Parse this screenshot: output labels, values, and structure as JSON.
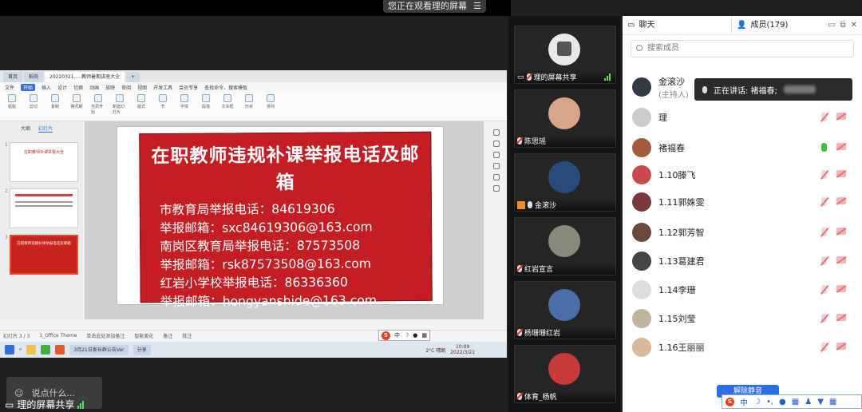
{
  "banner": {
    "text": "您正在观看理的屏幕"
  },
  "share_label": "理的屏幕共享",
  "chat_placeholder": "说点什么...",
  "ppt": {
    "tabs": [
      "首页",
      "稻壳",
      "20220321.....教师暑期讲座大全",
      "+"
    ],
    "menus": [
      "文件",
      "开始",
      "插入",
      "设计",
      "切换",
      "动画",
      "放映",
      "审阅",
      "视图",
      "开发工具",
      "会员专享",
      "查找命令、搜索模板"
    ],
    "ribbon": [
      "粘贴",
      "剪切",
      "复制",
      "格式刷",
      "当页开始",
      "新建幻灯片",
      "版式",
      "节",
      "字体",
      "段落",
      "文本框",
      "形状",
      "排列"
    ],
    "pane_tabs": [
      "大纲",
      "幻灯片"
    ],
    "slide_numbers": [
      "1",
      "2",
      "3"
    ],
    "thumb1_title": "在职教师补课举报大全",
    "thumb3_title": "在职教师违规补课举报电话及邮箱",
    "slide": {
      "title": "在职教师违规补课举报电话及邮箱",
      "lines": [
        "市教育局举报电话：84619306",
        "举报邮箱：sxc84619306@163.com",
        "南岗区教育局举报电话：87573508",
        "举报邮箱：rsk87573508@163.com",
        "红岩小学校举报电话：86336360",
        "举报邮箱：hongyanshide@163.com"
      ]
    },
    "status": [
      "幻灯片 3 / 3",
      "1_Office Theme",
      "智能美化",
      "备注",
      "批注"
    ],
    "notes_hint": "单击此处添加备注",
    "taskbar": {
      "apps": [
        "3月21日家长群公告Ver",
        "分享"
      ],
      "weather": "2°C 晴朗",
      "time": "10:09",
      "date": "2022/3/21"
    },
    "ime_text": "中"
  },
  "tiles": [
    {
      "name": "理的屏幕共享",
      "type": "share"
    },
    {
      "name": "陈思瑶",
      "type": "muted"
    },
    {
      "name": "金滚沙",
      "type": "host"
    },
    {
      "name": "红岩宣言",
      "type": "muted"
    },
    {
      "name": "杨珊珊红岩",
      "type": "muted"
    },
    {
      "name": "体育_杨帆",
      "type": "muted"
    }
  ],
  "panel": {
    "chat_tab": "聊天",
    "members_tab": "成员(179)",
    "search_placeholder": "搜索成员",
    "talking_label": "正在讲话: 褚福春;",
    "unmute_label": "解除静音",
    "members": [
      {
        "name": "金滚沙",
        "sub": "(主持人)",
        "mic": "off",
        "cam": "off"
      },
      {
        "name": "理",
        "sub": "",
        "mic": "off",
        "cam": "off"
      },
      {
        "name": "褚福春",
        "sub": "",
        "mic": "on",
        "cam": "off"
      },
      {
        "name": "1.10滕飞",
        "sub": "",
        "mic": "off",
        "cam": "off"
      },
      {
        "name": "1.11郭姝雯",
        "sub": "",
        "mic": "off",
        "cam": "off"
      },
      {
        "name": "1.12郭芳智",
        "sub": "",
        "mic": "off",
        "cam": "off"
      },
      {
        "name": "1.13葛建君",
        "sub": "",
        "mic": "off",
        "cam": "off"
      },
      {
        "name": "1.14李珊",
        "sub": "",
        "mic": "off",
        "cam": "off"
      },
      {
        "name": "1.15刘莹",
        "sub": "",
        "mic": "off",
        "cam": "off"
      },
      {
        "name": "1.16王丽丽",
        "sub": "",
        "mic": "off",
        "cam": "off"
      }
    ]
  }
}
